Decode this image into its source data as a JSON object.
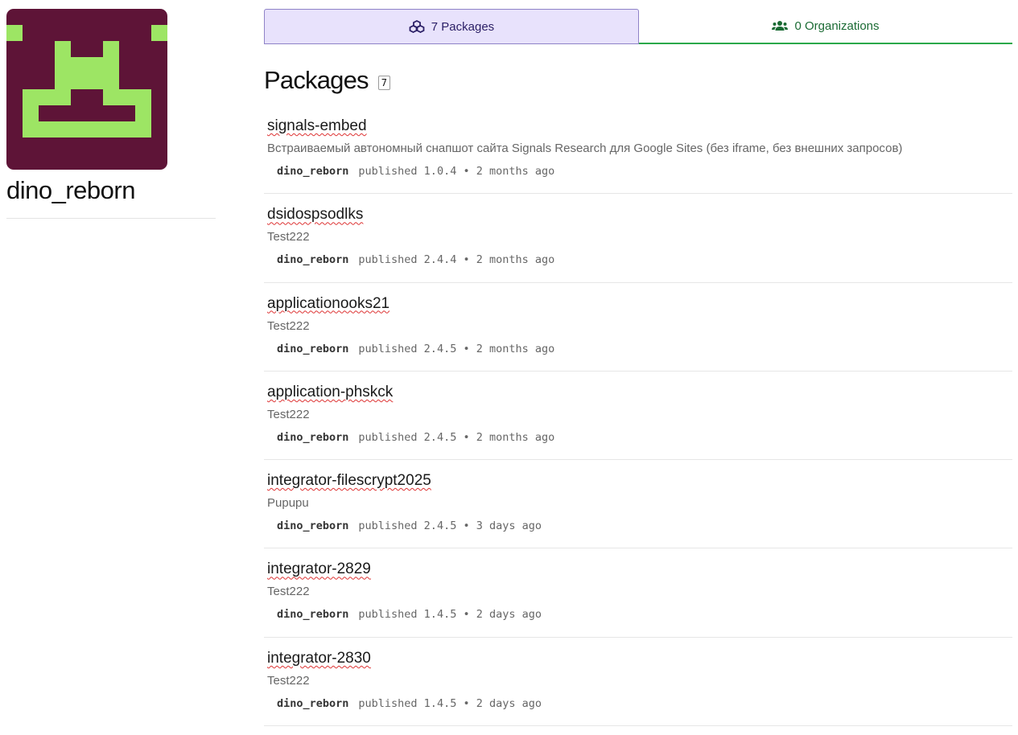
{
  "profile": {
    "username": "dino_reborn",
    "avatar_colors": {
      "background": "#5e1437",
      "foreground": "#9de564"
    }
  },
  "tabs": {
    "packages": {
      "label": "7 Packages",
      "icon": "cubes-icon"
    },
    "organizations": {
      "label": "0 Organizations",
      "icon": "users-icon"
    }
  },
  "section": {
    "title": "Packages",
    "count": "7"
  },
  "packages": [
    {
      "name": "signals-embed",
      "description": "Встраиваемый автономный снапшот сайта Signals Research для Google Sites (без iframe, без внешних запросов)",
      "author": "dino_reborn",
      "published": "published 1.0.4 • 2 months ago"
    },
    {
      "name": "dsidospsodlks",
      "description": "Test222",
      "author": "dino_reborn",
      "published": "published 2.4.4 • 2 months ago"
    },
    {
      "name": "applicationooks21",
      "description": "Test222",
      "author": "dino_reborn",
      "published": "published 2.4.5 • 2 months ago"
    },
    {
      "name": "application-phskck",
      "description": "Test222",
      "author": "dino_reborn",
      "published": "published 2.4.5 • 2 months ago"
    },
    {
      "name": "integrator-filescrypt2025",
      "description": "Pupupu",
      "author": "dino_reborn",
      "published": "published 2.4.5 • 3 days ago"
    },
    {
      "name": "integrator-2829",
      "description": "Test222",
      "author": "dino_reborn",
      "published": "published 1.4.5 • 2 days ago"
    },
    {
      "name": "integrator-2830",
      "description": "Test222",
      "author": "dino_reborn",
      "published": "published 1.4.5 • 2 days ago"
    }
  ]
}
